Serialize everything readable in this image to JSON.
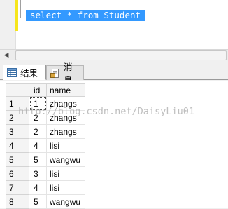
{
  "editor": {
    "sql_text": "select * from Student"
  },
  "tabs": [
    {
      "label": "结果",
      "icon": "grid-icon",
      "active": true
    },
    {
      "label": "消息",
      "icon": "message-icon",
      "active": false
    }
  ],
  "grid": {
    "columns": [
      "id",
      "name"
    ],
    "rows": [
      {
        "num": "1",
        "id": "1",
        "name": "zhangs"
      },
      {
        "num": "2",
        "id": "2",
        "name": "zhangs"
      },
      {
        "num": "3",
        "id": "2",
        "name": "zhangs"
      },
      {
        "num": "4",
        "id": "4",
        "name": "lisi"
      },
      {
        "num": "5",
        "id": "5",
        "name": "wangwu"
      },
      {
        "num": "6",
        "id": "3",
        "name": "lisi"
      },
      {
        "num": "7",
        "id": "4",
        "name": "lisi"
      },
      {
        "num": "8",
        "id": "5",
        "name": "wangwu"
      }
    ]
  },
  "watermark": "http://blog.csdn.net/DaisyLiu01",
  "colors": {
    "selection": "#3399ff",
    "change_bar": "#f6e51c"
  }
}
